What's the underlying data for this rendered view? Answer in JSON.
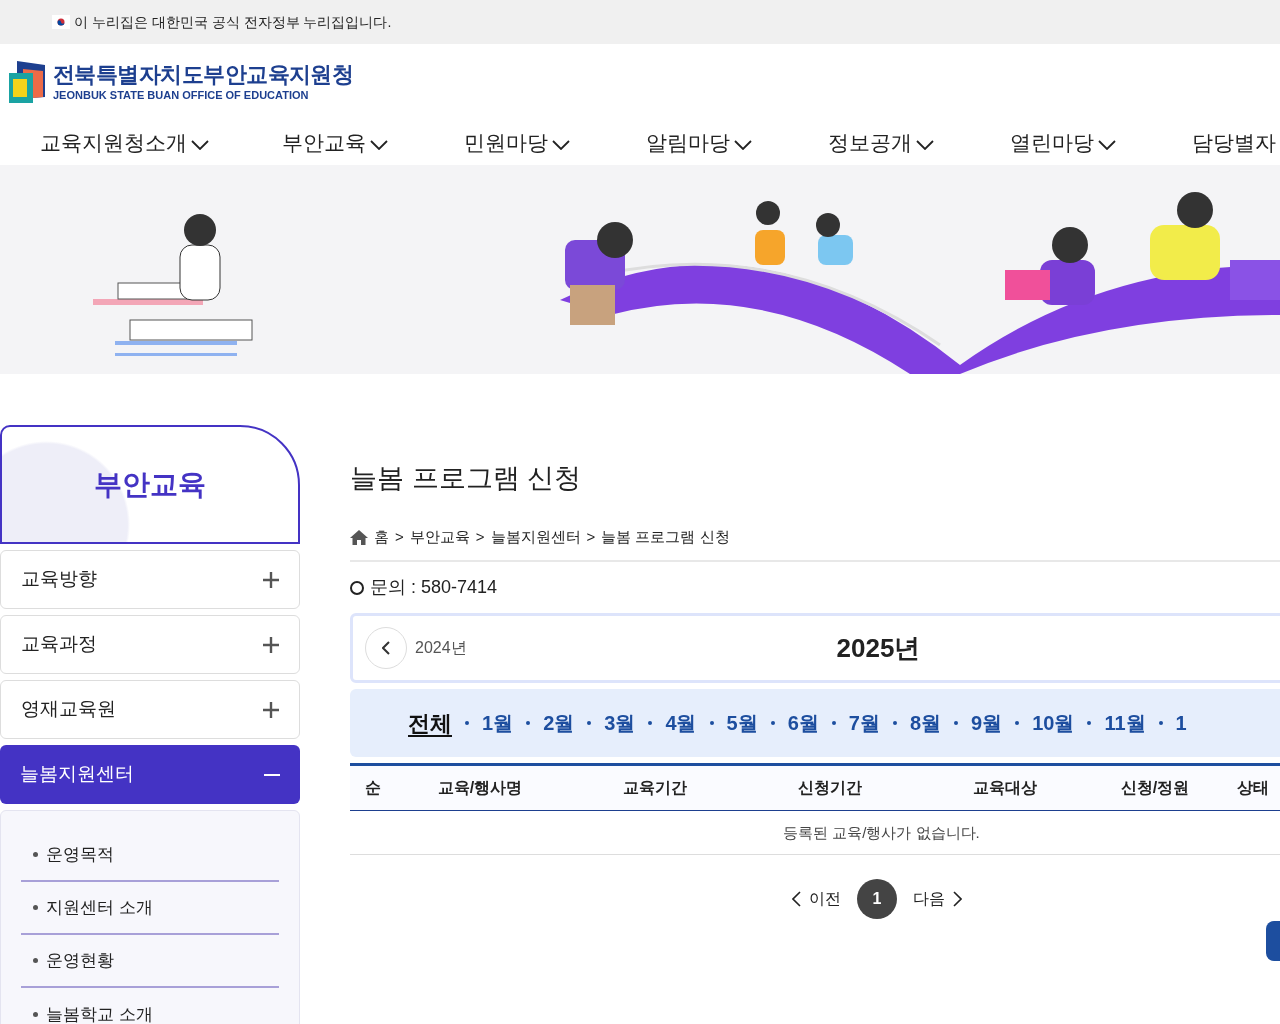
{
  "gov_banner": {
    "text": "이 누리집은 대한민국 공식 전자정부 누리집입니다."
  },
  "logo": {
    "title": "전북특별자치도부안교육지원청",
    "subtitle": "JEONBUK STATE BUAN OFFICE OF EDUCATION"
  },
  "nav": [
    {
      "label": "교육지원청소개",
      "dropdown": true
    },
    {
      "label": "부안교육",
      "dropdown": true
    },
    {
      "label": "민원마당",
      "dropdown": true
    },
    {
      "label": "알림마당",
      "dropdown": true
    },
    {
      "label": "정보공개",
      "dropdown": true
    },
    {
      "label": "열린마당",
      "dropdown": true
    },
    {
      "label": "담당별자",
      "dropdown": false
    }
  ],
  "sidebar": {
    "title": "부안교육",
    "items": [
      {
        "label": "교육방향",
        "expanded": false
      },
      {
        "label": "교육과정",
        "expanded": false
      },
      {
        "label": "영재교육원",
        "expanded": false
      },
      {
        "label": "늘봄지원센터",
        "expanded": true,
        "children": [
          {
            "label": "운영목적"
          },
          {
            "label": "지원센터 소개"
          },
          {
            "label": "운영현황"
          },
          {
            "label": "늘봄학교 소개"
          }
        ]
      }
    ]
  },
  "page": {
    "title": "늘봄 프로그램 신청",
    "breadcrumb": [
      "홈",
      "부안교육",
      "늘봄지원센터",
      "늘봄 프로그램 신청"
    ],
    "breadcrumb_separator": ">",
    "inquiry": "문의 : 580-7414"
  },
  "year_nav": {
    "previous": "2024년",
    "current": "2025년"
  },
  "months": [
    {
      "label": "전체",
      "selected": true
    },
    {
      "label": "1월",
      "selected": false
    },
    {
      "label": "2월",
      "selected": false
    },
    {
      "label": "3월",
      "selected": false
    },
    {
      "label": "4월",
      "selected": false
    },
    {
      "label": "5월",
      "selected": false
    },
    {
      "label": "6월",
      "selected": false
    },
    {
      "label": "7월",
      "selected": false
    },
    {
      "label": "8월",
      "selected": false
    },
    {
      "label": "9월",
      "selected": false
    },
    {
      "label": "10월",
      "selected": false
    },
    {
      "label": "11월",
      "selected": false
    },
    {
      "label": "1",
      "selected": false
    }
  ],
  "table": {
    "columns": [
      "순",
      "교육/행사명",
      "교육기간",
      "신청기간",
      "교육대상",
      "신청/정원",
      "상태"
    ],
    "empty_message": "등록된 교육/행사가 없습니다."
  },
  "pagination": {
    "previous": "이전",
    "pages": [
      {
        "label": "1",
        "selected": true
      }
    ],
    "next": "다음"
  }
}
